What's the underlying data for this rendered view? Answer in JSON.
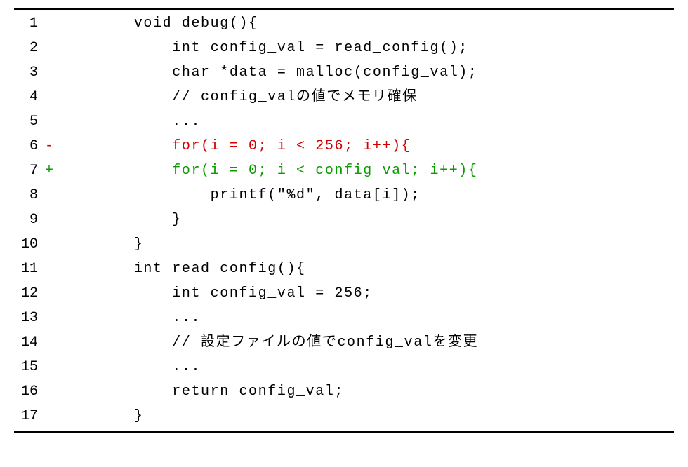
{
  "colors": {
    "minus": "#d40000",
    "plus": "#0a9b00",
    "text": "#000000",
    "rule": "#000000",
    "bg": "#ffffff"
  },
  "indent_unit": "    ",
  "lines": [
    {
      "n": "1",
      "diff": "",
      "kind": "",
      "indent": 2,
      "text": "void debug(){"
    },
    {
      "n": "2",
      "diff": "",
      "kind": "",
      "indent": 3,
      "text": "int config_val = read_config();"
    },
    {
      "n": "3",
      "diff": "",
      "kind": "",
      "indent": 3,
      "text": "char *data = malloc(config_val);"
    },
    {
      "n": "4",
      "diff": "",
      "kind": "",
      "indent": 3,
      "text": "// config_valの値でメモリ確保"
    },
    {
      "n": "5",
      "diff": "",
      "kind": "",
      "indent": 3,
      "text": "..."
    },
    {
      "n": "6",
      "diff": "-",
      "kind": "minus",
      "indent": 3,
      "text": "for(i = 0; i < 256; i++){"
    },
    {
      "n": "7",
      "diff": "+",
      "kind": "plus",
      "indent": 3,
      "text": "for(i = 0; i < config_val; i++){"
    },
    {
      "n": "8",
      "diff": "",
      "kind": "",
      "indent": 4,
      "text": "printf(\"%d\", data[i]);"
    },
    {
      "n": "9",
      "diff": "",
      "kind": "",
      "indent": 3,
      "text": "}"
    },
    {
      "n": "10",
      "diff": "",
      "kind": "",
      "indent": 2,
      "text": "}"
    },
    {
      "n": "11",
      "diff": "",
      "kind": "",
      "indent": 2,
      "text": "int read_config(){"
    },
    {
      "n": "12",
      "diff": "",
      "kind": "",
      "indent": 3,
      "text": "int config_val = 256;"
    },
    {
      "n": "13",
      "diff": "",
      "kind": "",
      "indent": 3,
      "text": "..."
    },
    {
      "n": "14",
      "diff": "",
      "kind": "",
      "indent": 3,
      "text": "// 設定ファイルの値でconfig_valを変更"
    },
    {
      "n": "15",
      "diff": "",
      "kind": "",
      "indent": 3,
      "text": "..."
    },
    {
      "n": "16",
      "diff": "",
      "kind": "",
      "indent": 3,
      "text": "return config_val;"
    },
    {
      "n": "17",
      "diff": "",
      "kind": "",
      "indent": 2,
      "text": "}"
    }
  ]
}
